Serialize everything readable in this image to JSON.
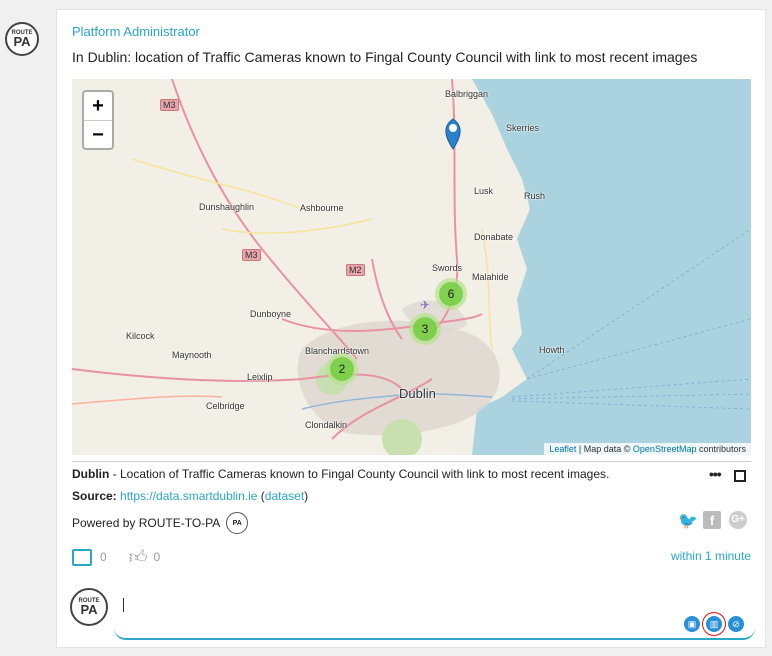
{
  "post": {
    "author": "Platform Administrator",
    "description": "In Dublin: location of Traffic Cameras known to Fingal County Council with link to most recent images",
    "caption_title": "Dublin",
    "caption_text": " - Location of Traffic Cameras known to Fingal County Council with link to most recent images.",
    "source_label": "Source:",
    "source_url": "https://data.smartdublin.ie",
    "dataset_label": "dataset",
    "powered_by": "Powered by ROUTE-TO-PA",
    "comment_count": "0",
    "like_count": "0",
    "time": "within 1 minute"
  },
  "logo": {
    "top": "ROUTE",
    "mid": "TO",
    "bottom": "PA"
  },
  "map": {
    "zoom_in": "+",
    "zoom_out": "−",
    "attribution_leaflet": "Leaflet",
    "attribution_mid": " | Map data © ",
    "attribution_osm": "OpenStreetMap",
    "attribution_end": " contributors",
    "clusters": [
      {
        "count": "6"
      },
      {
        "count": "3"
      },
      {
        "count": "2"
      }
    ],
    "places": [
      "Balbriggan",
      "Skerries",
      "Lusk",
      "Rush",
      "Dunshaughlin",
      "Ashbourne",
      "Donabate",
      "Swords",
      "Malahide",
      "Dunboyne",
      "Kilcock",
      "Maynooth",
      "Blanchardstown",
      "Howth",
      "Leixlip",
      "Dublin",
      "Celbridge",
      "Clondalkin"
    ],
    "road_signs": [
      "M3",
      "M3",
      "M2"
    ]
  },
  "icons": {
    "twitter": "twitter-icon",
    "facebook": "facebook-icon",
    "google": "google-plus-icon",
    "comment": "comment-icon",
    "like": "thumbs-up-icon"
  },
  "colors": {
    "accent": "#2aa6c9",
    "sea": "#aad3df",
    "cluster": "#6ecc39",
    "marker": "#2a81cb"
  }
}
